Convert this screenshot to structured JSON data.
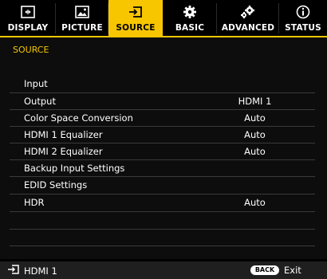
{
  "tabs": [
    {
      "label": "DISPLAY",
      "icon": "display-icon",
      "active": false
    },
    {
      "label": "PICTURE",
      "icon": "picture-icon",
      "active": false
    },
    {
      "label": "SOURCE",
      "icon": "source-icon",
      "active": true
    },
    {
      "label": "BASIC",
      "icon": "gear-icon",
      "active": false
    },
    {
      "label": "ADVANCED",
      "icon": "gears-icon",
      "active": false
    },
    {
      "label": "STATUS",
      "icon": "info-icon",
      "active": false
    }
  ],
  "section_title": "SOURCE",
  "menu": [
    {
      "label": "Input",
      "value": ""
    },
    {
      "label": "Output",
      "value": "HDMI 1"
    },
    {
      "label": "Color Space Conversion",
      "value": "Auto"
    },
    {
      "label": "HDMI 1 Equalizer",
      "value": "Auto"
    },
    {
      "label": "HDMI 2 Equalizer",
      "value": "Auto"
    },
    {
      "label": "Backup Input Settings",
      "value": ""
    },
    {
      "label": "EDID Settings",
      "value": ""
    },
    {
      "label": "HDR",
      "value": "Auto"
    }
  ],
  "footer": {
    "current_source": "HDMI 1",
    "back_button": "BACK",
    "exit_label": "Exit"
  },
  "colors": {
    "accent": "#f7c600",
    "background": "#000000",
    "footer": "#1f1f1f"
  }
}
